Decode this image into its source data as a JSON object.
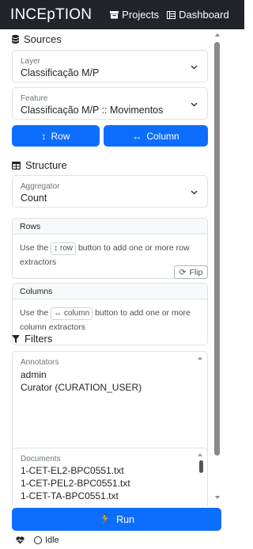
{
  "navbar": {
    "brand": "INCEpTION",
    "projects": "Projects",
    "dashboard": "Dashboard"
  },
  "sources": {
    "title": "Sources",
    "layer": {
      "label": "Layer",
      "value": "Classificação M/P"
    },
    "feature": {
      "label": "Feature",
      "value": "Classificação M/P :: Movimentos"
    },
    "row_button": "Row",
    "column_button": "Column"
  },
  "structure": {
    "title": "Structure",
    "aggregator": {
      "label": "Aggregator",
      "value": "Count"
    },
    "rows": {
      "header": "Rows",
      "text_before": "Use the",
      "button": "row",
      "text_after": "button to add one or more row extractors"
    },
    "flip": "Flip",
    "columns": {
      "header": "Columns",
      "text_before": "Use the",
      "button": "column",
      "text_after": "button to add one or more column extractors"
    }
  },
  "filters": {
    "title": "Filters",
    "annotators": {
      "label": "Annotators",
      "options": [
        "admin",
        "Curator (CURATION_USER)"
      ]
    },
    "documents": {
      "label": "Documents",
      "options": [
        "1-CET-EL2-BPC0551.txt",
        "1-CET-PEL2-BPC0551.txt",
        "1-CET-TA-BPC0551.txt"
      ]
    }
  },
  "run_button": "Run",
  "status": {
    "text": "Idle"
  },
  "colors": {
    "primary": "#0d6efd",
    "navbar": "#212529"
  }
}
